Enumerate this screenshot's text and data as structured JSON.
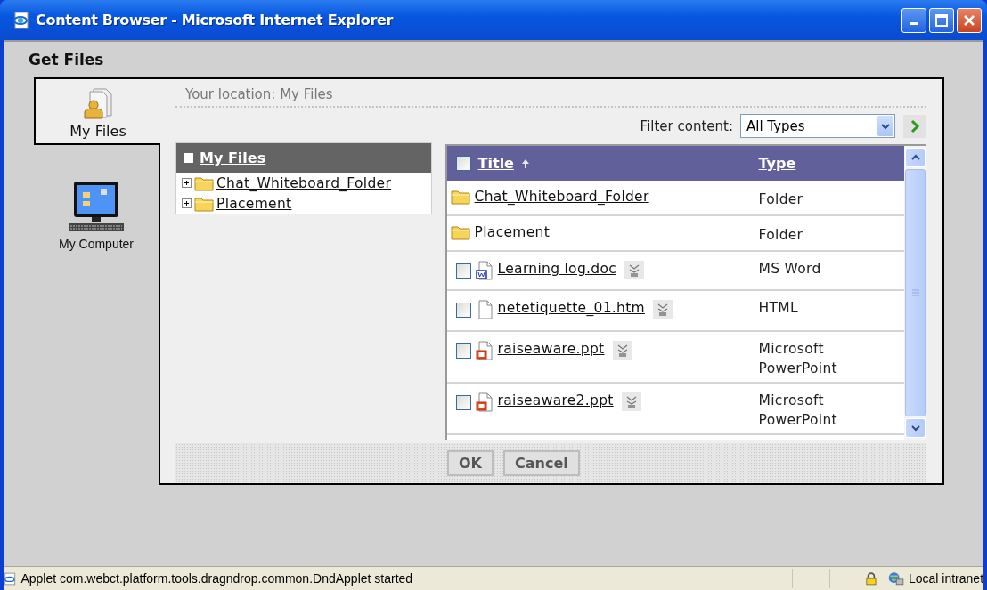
{
  "window": {
    "title": "Content Browser - Microsoft Internet Explorer"
  },
  "heading": "Get Files",
  "tabs": [
    {
      "kind": "files",
      "label": "My Files",
      "selected": true
    },
    {
      "kind": "computer",
      "label": "My Computer",
      "selected": false
    }
  ],
  "location": "Your location: My Files",
  "filter": {
    "label": "Filter content:",
    "value": "All Types"
  },
  "tree": {
    "label": "My Files",
    "children": [
      {
        "label": "Chat_Whiteboard_Folder",
        "expanded": false
      },
      {
        "label": "Placement",
        "expanded": false
      }
    ]
  },
  "table": {
    "columns": [
      "Title",
      "Type"
    ],
    "select_all_checked": false,
    "rows": [
      {
        "kind": "folder",
        "title": "Chat_Whiteboard_Folder",
        "type": "Folder"
      },
      {
        "kind": "folder",
        "title": "Placement",
        "type": "Folder"
      },
      {
        "kind": "word",
        "title": "Learning log.doc",
        "type": "MS Word",
        "checked": false
      },
      {
        "kind": "page",
        "title": "netetiquette_01.htm",
        "type": "HTML",
        "checked": false
      },
      {
        "kind": "slides",
        "title": "raiseaware.ppt",
        "type": "Microsoft PowerPoint",
        "checked": false
      },
      {
        "kind": "slides",
        "title": "raiseaware2.ppt",
        "type": "Microsoft PowerPoint",
        "checked": false
      }
    ]
  },
  "buttons": [
    "OK",
    "Cancel"
  ],
  "status_bar": {
    "text": "Applet com.webct.platform.tools.dragndrop.common.DndApplet started",
    "zone": "Local intranet"
  }
}
